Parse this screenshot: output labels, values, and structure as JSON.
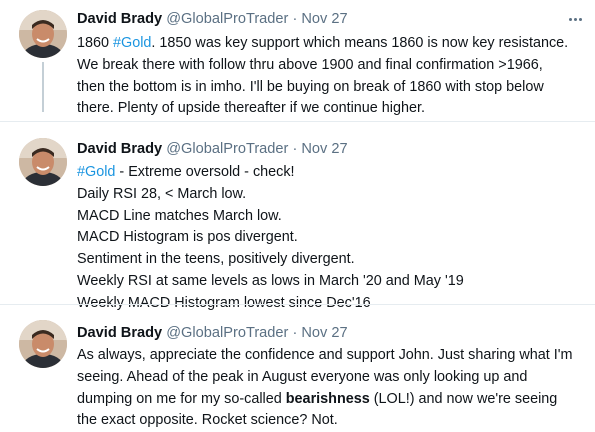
{
  "colors": {
    "text": "#0f1419",
    "secondary": "#5b7083",
    "hashtag": "#1b95e0",
    "separator": "#e6ecf0",
    "thread_line": "#c4cfd6"
  },
  "tweets": [
    {
      "author": "David Brady",
      "handle": "@GlobalProTrader",
      "separator_dot": "·",
      "date": "Nov 27",
      "more_icon": "more-horizontal-icon",
      "lines": [
        {
          "hashtag_prefix": "1860 ",
          "hashtag": "#Gold",
          "rest": ". 1850 was key support which means 1860 is now key resistance."
        },
        {
          "text": "We break there with follow thru above 1900 and final confirmation >1966,"
        },
        {
          "text": "then the bottom is in imho. I'll be buying on break of 1860 with stop below"
        },
        {
          "text": "there. Plenty of upside thereafter if we continue higher."
        }
      ]
    },
    {
      "author": "David Brady",
      "handle": "@GlobalProTrader",
      "separator_dot": "·",
      "date": "Nov 27",
      "more_icon": "more-horizontal-icon",
      "lines": [
        {
          "hashtag": "#Gold",
          "rest": " - Extreme oversold - check!"
        },
        {
          "text": "Daily RSI 28, < March low."
        },
        {
          "text": "MACD Line matches March low."
        },
        {
          "text": "MACD Histogram is pos divergent."
        },
        {
          "text": "Sentiment in the teens, positively divergent."
        },
        {
          "text": "Weekly RSI at same levels as lows in March '20 and May '19"
        },
        {
          "text": "Weekly MACD Histogram lowest since Dec'16"
        }
      ]
    },
    {
      "author": "David Brady",
      "handle": "@GlobalProTrader",
      "separator_dot": "·",
      "date": "Nov 27",
      "more_icon": "more-horizontal-icon",
      "lines": [
        {
          "text": "As always, appreciate the confidence and support John. Just sharing what I'm"
        },
        {
          "text": "seeing. Ahead of the peak in August everyone was only looking up and"
        },
        {
          "before": "dumping on me for my so-called ",
          "bold": "bearishness",
          "after": " (LOL!) and now we're seeing"
        },
        {
          "text": "the exact opposite. Rocket science? Not."
        }
      ]
    }
  ]
}
